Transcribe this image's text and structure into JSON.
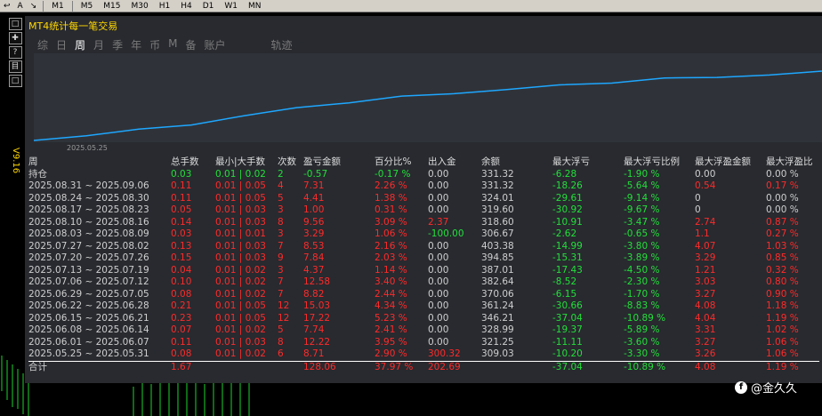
{
  "toolbar": {
    "tools": [
      "↩",
      "A",
      "↘"
    ],
    "timeframes": [
      "M1",
      "M5",
      "M15",
      "M30",
      "H1",
      "H4",
      "D1",
      "W1",
      "MN"
    ]
  },
  "left_tools": [
    "□",
    "✚",
    "?",
    "目",
    "□"
  ],
  "side_tag": "V9.16",
  "panel": {
    "title": "MT4统计每一笔交易",
    "tabs": [
      "综",
      "日",
      "周",
      "月",
      "季",
      "年",
      "币",
      "M",
      "备",
      "账户",
      "轨迹"
    ],
    "active_tab": 2,
    "chart_x_label": "2025.05.25"
  },
  "colors": {
    "curve": "#1ea7ff",
    "profit": "#ff2a2a",
    "loss": "#22e03a",
    "title": "#ffd700"
  },
  "table": {
    "headers": [
      "周",
      "总手数",
      "最小|大手数",
      "次数",
      "盈亏金额",
      "百分比%",
      "出入金",
      "余额",
      "最大浮亏",
      "最大浮亏比例",
      "最大浮盈金额",
      "最大浮盈比"
    ],
    "holding": {
      "label": "持仓",
      "lots": "0.03",
      "minmax": "0.01 | 0.02",
      "count": "2",
      "pnl": "-0.57",
      "pct": "-0.17 %",
      "io": "0.00",
      "balance": "331.32",
      "max_dd": "-6.28",
      "max_dd_pct": "-1.90 %",
      "max_fp": "0.00",
      "max_fp_pct": "0.00 %"
    },
    "rows": [
      {
        "period": "2025.08.31 ~ 2025.09.06",
        "lots": "0.11",
        "minmax": "0.01 | 0.05",
        "count": "4",
        "pnl": "7.31",
        "pct": "2.26 %",
        "io": "0.00",
        "balance": "331.32",
        "max_dd": "-18.26",
        "max_dd_pct": "-5.64 %",
        "max_fp": "0.54",
        "max_fp_pct": "0.17 %"
      },
      {
        "period": "2025.08.24 ~ 2025.08.30",
        "lots": "0.11",
        "minmax": "0.01 | 0.05",
        "count": "5",
        "pnl": "4.41",
        "pct": "1.38 %",
        "io": "0.00",
        "balance": "324.01",
        "max_dd": "-29.61",
        "max_dd_pct": "-9.14 %",
        "max_fp": "0",
        "max_fp_pct": "0.00 %"
      },
      {
        "period": "2025.08.17 ~ 2025.08.23",
        "lots": "0.05",
        "minmax": "0.01 | 0.03",
        "count": "3",
        "pnl": "1.00",
        "pct": "0.31 %",
        "io": "0.00",
        "balance": "319.60",
        "max_dd": "-30.92",
        "max_dd_pct": "-9.67 %",
        "max_fp": "0",
        "max_fp_pct": "0.00 %"
      },
      {
        "period": "2025.08.10 ~ 2025.08.16",
        "lots": "0.14",
        "minmax": "0.01 | 0.03",
        "count": "8",
        "pnl": "9.56",
        "pct": "3.09 %",
        "io": "2.37",
        "balance": "318.60",
        "max_dd": "-10.91",
        "max_dd_pct": "-3.47 %",
        "max_fp": "2.74",
        "max_fp_pct": "0.87 %"
      },
      {
        "period": "2025.08.03 ~ 2025.08.09",
        "lots": "0.03",
        "minmax": "0.01 | 0.01",
        "count": "3",
        "pnl": "3.29",
        "pct": "1.06 %",
        "io": "-100.00",
        "balance": "306.67",
        "max_dd": "-2.62",
        "max_dd_pct": "-0.65 %",
        "max_fp": "1.1",
        "max_fp_pct": "0.27 %"
      },
      {
        "period": "2025.07.27 ~ 2025.08.02",
        "lots": "0.13",
        "minmax": "0.01 | 0.03",
        "count": "7",
        "pnl": "8.53",
        "pct": "2.16 %",
        "io": "0.00",
        "balance": "403.38",
        "max_dd": "-14.99",
        "max_dd_pct": "-3.80 %",
        "max_fp": "4.07",
        "max_fp_pct": "1.03 %"
      },
      {
        "period": "2025.07.20 ~ 2025.07.26",
        "lots": "0.15",
        "minmax": "0.01 | 0.03",
        "count": "9",
        "pnl": "7.84",
        "pct": "2.03 %",
        "io": "0.00",
        "balance": "394.85",
        "max_dd": "-15.31",
        "max_dd_pct": "-3.89 %",
        "max_fp": "3.29",
        "max_fp_pct": "0.85 %"
      },
      {
        "period": "2025.07.13 ~ 2025.07.19",
        "lots": "0.04",
        "minmax": "0.01 | 0.02",
        "count": "3",
        "pnl": "4.37",
        "pct": "1.14 %",
        "io": "0.00",
        "balance": "387.01",
        "max_dd": "-17.43",
        "max_dd_pct": "-4.50 %",
        "max_fp": "1.21",
        "max_fp_pct": "0.32 %"
      },
      {
        "period": "2025.07.06 ~ 2025.07.12",
        "lots": "0.10",
        "minmax": "0.01 | 0.02",
        "count": "7",
        "pnl": "12.58",
        "pct": "3.40 %",
        "io": "0.00",
        "balance": "382.64",
        "max_dd": "-8.52",
        "max_dd_pct": "-2.30 %",
        "max_fp": "3.03",
        "max_fp_pct": "0.80 %"
      },
      {
        "period": "2025.06.29 ~ 2025.07.05",
        "lots": "0.08",
        "minmax": "0.01 | 0.02",
        "count": "7",
        "pnl": "8.82",
        "pct": "2.44 %",
        "io": "0.00",
        "balance": "370.06",
        "max_dd": "-6.15",
        "max_dd_pct": "-1.70 %",
        "max_fp": "3.27",
        "max_fp_pct": "0.90 %"
      },
      {
        "period": "2025.06.22 ~ 2025.06.28",
        "lots": "0.21",
        "minmax": "0.01 | 0.05",
        "count": "12",
        "pnl": "15.03",
        "pct": "4.34 %",
        "io": "0.00",
        "balance": "361.24",
        "max_dd": "-30.66",
        "max_dd_pct": "-8.83 %",
        "max_fp": "4.08",
        "max_fp_pct": "1.18 %"
      },
      {
        "period": "2025.06.15 ~ 2025.06.21",
        "lots": "0.23",
        "minmax": "0.01 | 0.05",
        "count": "12",
        "pnl": "17.22",
        "pct": "5.23 %",
        "io": "0.00",
        "balance": "346.21",
        "max_dd": "-37.04",
        "max_dd_pct": "-10.89 %",
        "max_fp": "4.04",
        "max_fp_pct": "1.19 %"
      },
      {
        "period": "2025.06.08 ~ 2025.06.14",
        "lots": "0.07",
        "minmax": "0.01 | 0.02",
        "count": "5",
        "pnl": "7.74",
        "pct": "2.41 %",
        "io": "0.00",
        "balance": "328.99",
        "max_dd": "-19.37",
        "max_dd_pct": "-5.89 %",
        "max_fp": "3.31",
        "max_fp_pct": "1.02 %"
      },
      {
        "period": "2025.06.01 ~ 2025.06.07",
        "lots": "0.11",
        "minmax": "0.01 | 0.03",
        "count": "8",
        "pnl": "12.22",
        "pct": "3.95 %",
        "io": "0.00",
        "balance": "321.25",
        "max_dd": "-11.11",
        "max_dd_pct": "-3.60 %",
        "max_fp": "3.27",
        "max_fp_pct": "1.06 %"
      },
      {
        "period": "2025.05.25 ~ 2025.05.31",
        "lots": "0.08",
        "minmax": "0.01 | 0.02",
        "count": "6",
        "pnl": "8.71",
        "pct": "2.90 %",
        "io": "300.32",
        "balance": "309.03",
        "max_dd": "-10.20",
        "max_dd_pct": "-3.30 %",
        "max_fp": "3.26",
        "max_fp_pct": "1.06 %"
      }
    ],
    "total": {
      "label": "合计",
      "lots": "1.67",
      "minmax": "",
      "count": "",
      "pnl": "128.06",
      "pct": "37.97 %",
      "io": "202.69",
      "balance": "",
      "max_dd": "-37.04",
      "max_dd_pct": "-10.89 %",
      "max_fp": "4.08",
      "max_fp_pct": "1.19 %"
    }
  },
  "watermark": {
    "text": "@金久久"
  }
}
